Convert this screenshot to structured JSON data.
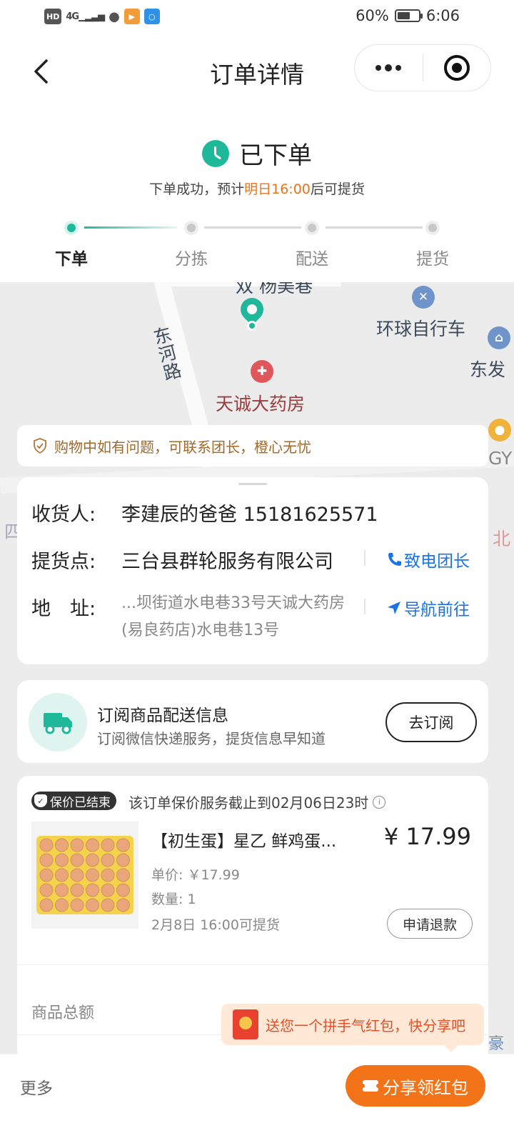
{
  "status_bar": {
    "hd": "HD",
    "network": "4G",
    "battery_percent": "60%",
    "battery_level": 0.6,
    "time": "6:06"
  },
  "nav": {
    "title": "订单详情"
  },
  "order_status": {
    "title": "已下单",
    "sub_prefix": "下单成功，预计",
    "sub_highlight": "明日16:00",
    "sub_suffix": "后可提货",
    "steps": [
      "下单",
      "分拣",
      "配送",
      "提货"
    ],
    "current_step": 0
  },
  "map": {
    "labels": {
      "top_cut": "双 杨美巷",
      "road": "东河路",
      "bike_shop": "环球自行车",
      "pharmacy": "天诚大药房",
      "east": "东发",
      "west": "四",
      "right_edge": "北",
      "gy": "GY",
      "bottom_right": "豪"
    }
  },
  "tip": {
    "text": "购物中如有问题，可联系团长，橙心无忧"
  },
  "address": {
    "receiver_label": "收货人:",
    "receiver_value": "李建辰的爸爸 15181625571",
    "pickup_label": "提货点:",
    "pickup_value": "三台县群轮服务有限公司",
    "call_label": "致电团长",
    "address_label": "地　址:",
    "address_value": "...坝街道水电巷33号天诚大药房(易良药店)水电巷13号",
    "nav_label": "导航前往"
  },
  "subscribe": {
    "title": "订阅商品配送信息",
    "desc": "订阅微信快递服务，提货信息早知道",
    "button": "去订阅"
  },
  "goods": {
    "badge": "保价已结束",
    "badge_note": "该订单保价服务截止到02月06日23时",
    "name": "【初生蛋】星乙 鲜鸡蛋...",
    "price": "¥ 17.99",
    "unit_price": "单价:  ￥17.99",
    "quantity": "数量:  1",
    "pickup_time": "2月8日 16:00可提货",
    "refund_button": "申请退款",
    "total_label": "商品总额"
  },
  "share_tip": {
    "text": "送您一个拼手气红包，快分享吧"
  },
  "bottom": {
    "more": "更多",
    "share_button": "分享领红包"
  },
  "colors": {
    "accent_green": "#1fb89a",
    "highlight_orange": "#e8741c",
    "link_blue": "#1a73e8",
    "share_orange": "#f37318"
  }
}
